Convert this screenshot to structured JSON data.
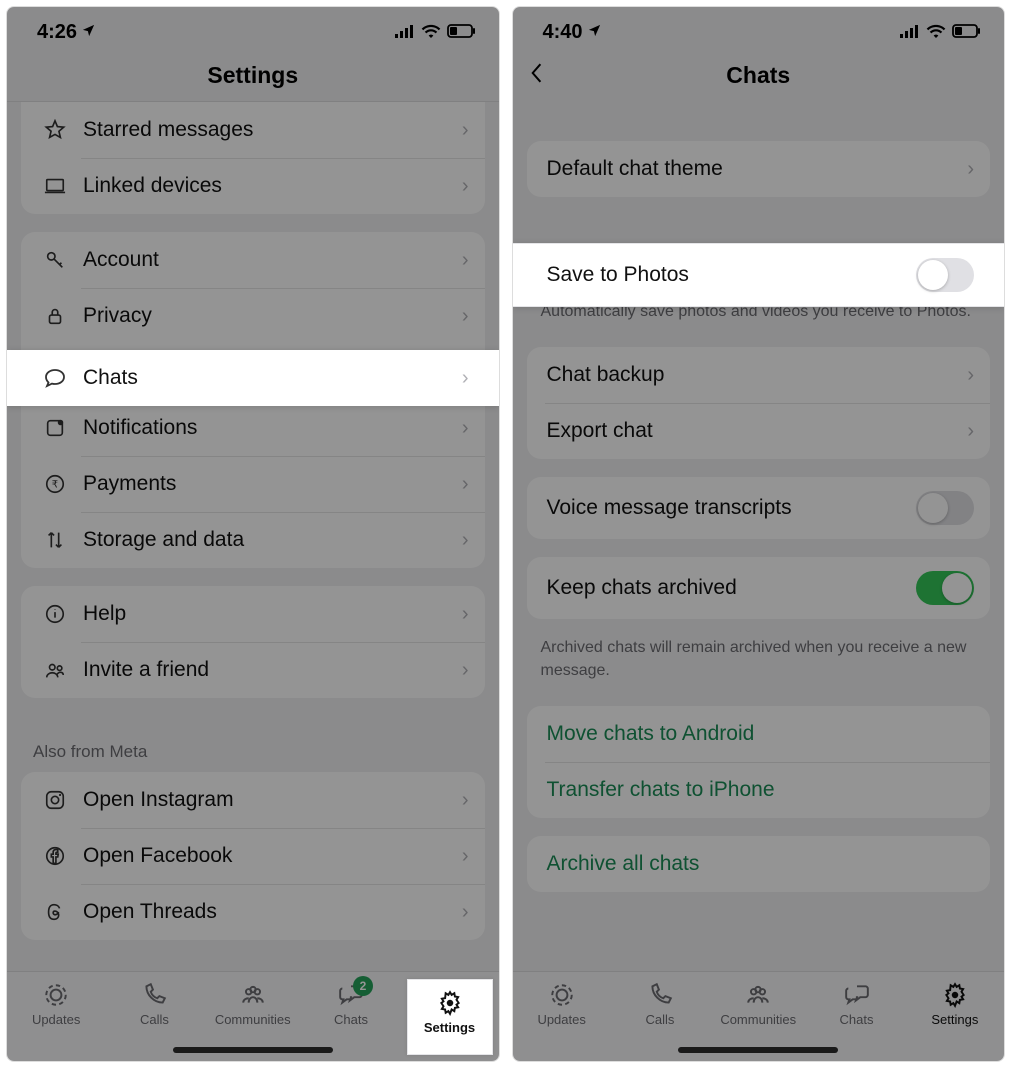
{
  "left": {
    "status": {
      "time": "4:26",
      "battery": "32"
    },
    "header": {
      "title": "Settings"
    },
    "group1": {
      "starred": "Starred messages",
      "linked": "Linked devices"
    },
    "group2": {
      "account": "Account",
      "privacy": "Privacy",
      "chats": "Chats",
      "notifications": "Notifications",
      "payments": "Payments",
      "storage": "Storage and data"
    },
    "group3": {
      "help": "Help",
      "invite": "Invite a friend"
    },
    "meta_caption": "Also from Meta",
    "group4": {
      "instagram": "Open Instagram",
      "facebook": "Open Facebook",
      "threads": "Open Threads"
    },
    "tabs": {
      "updates": "Updates",
      "calls": "Calls",
      "communities": "Communities",
      "chats": "Chats",
      "settings": "Settings",
      "chats_badge": "2"
    }
  },
  "right": {
    "status": {
      "time": "4:40",
      "battery": "30"
    },
    "header": {
      "title": "Chats"
    },
    "theme": {
      "default": "Default chat theme"
    },
    "save": {
      "label": "Save to Photos",
      "footnote": "Automatically save photos and videos you receive to Photos."
    },
    "backup": {
      "chat_backup": "Chat backup",
      "export": "Export chat"
    },
    "voice": {
      "label": "Voice message transcripts"
    },
    "archive": {
      "keep": "Keep chats archived",
      "footnote": "Archived chats will remain archived when you receive a new message."
    },
    "transfer": {
      "android": "Move chats to Android",
      "iphone": "Transfer chats to iPhone"
    },
    "archive_all": {
      "label": "Archive all chats"
    },
    "tabs": {
      "updates": "Updates",
      "calls": "Calls",
      "communities": "Communities",
      "chats": "Chats",
      "settings": "Settings"
    }
  }
}
